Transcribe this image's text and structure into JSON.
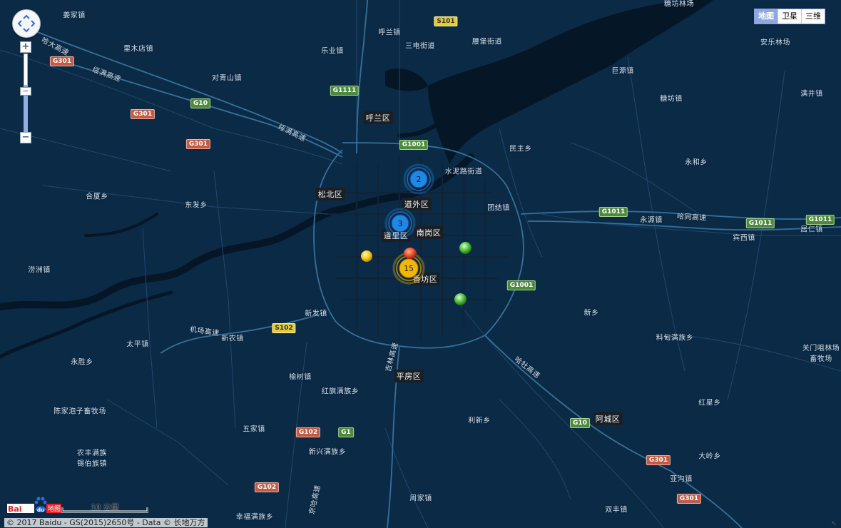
{
  "map": {
    "map_type_buttons": [
      {
        "label": "地图",
        "active": true
      },
      {
        "label": "卫星",
        "active": false
      },
      {
        "label": "三维",
        "active": false
      }
    ],
    "zoom": {
      "in_label": "+",
      "out_label": "−",
      "knob_label": "−",
      "level_fraction": 0.6
    },
    "scale_label": "10 公里",
    "copyright": "© 2017 Baidu - GS(2015)2650号 - Data © 长地万方",
    "logo_text": "Bai地图",
    "resize_glyph": "↖",
    "district_labels": [
      "呼兰区",
      "松北区",
      "道外区",
      "道里区",
      "南岗区",
      "香坊区",
      "平房区",
      "阿城区"
    ],
    "place_labels": [
      "姜家镇",
      "呼兰镇",
      "三电街道",
      "腰堡街道",
      "里木店镇",
      "乐业镇",
      "对青山镇",
      "巨源镇",
      "安乐林场",
      "糖坊镇",
      "满井镇",
      "民主乡",
      "永和乡",
      "水泥路街道",
      "合厦乡",
      "东发乡",
      "团结镇",
      "永源镇",
      "宾西镇",
      "居仁镇",
      "涝洲镇",
      "新发镇",
      "新乡",
      "新农镇",
      "太平镇",
      "料甸满族乡",
      "关门咀林场 畜牧场",
      "永胜乡",
      "榆树镇",
      "红旗满族乡",
      "红星乡",
      "陈家泡子畜牧场",
      "利新乡",
      "五家镇",
      "新兴满族乡",
      "大岭乡",
      "农丰满族 锡伯族镇",
      "亚沟镇",
      "周家镇",
      "幸福满族乡",
      "双丰镇",
      "糖坊林场"
    ],
    "road_labels": [
      "哈大高速",
      "绥满高速",
      "机场高速",
      "哈同高速",
      "吉林高速",
      "哈牡高速",
      "京哈高速"
    ],
    "highway_shields": [
      {
        "code": "S101",
        "color": "yellow"
      },
      {
        "code": "G301",
        "color": "red"
      },
      {
        "code": "G10",
        "color": "green"
      },
      {
        "code": "G1111",
        "color": "green"
      },
      {
        "code": "G301",
        "color": "red"
      },
      {
        "code": "G301",
        "color": "red"
      },
      {
        "code": "G1001",
        "color": "green"
      },
      {
        "code": "G1011",
        "color": "green"
      },
      {
        "code": "G1011",
        "color": "green"
      },
      {
        "code": "G1011",
        "color": "green"
      },
      {
        "code": "G1001",
        "color": "green"
      },
      {
        "code": "S102",
        "color": "yellow"
      },
      {
        "code": "G102",
        "color": "red"
      },
      {
        "code": "G1",
        "color": "green"
      },
      {
        "code": "G10",
        "color": "green"
      },
      {
        "code": "G301",
        "color": "red"
      },
      {
        "code": "G102",
        "color": "red"
      },
      {
        "code": "G301",
        "color": "red"
      }
    ],
    "cluster_markers": [
      {
        "count": "2",
        "color": "#1e88e5"
      },
      {
        "count": "3",
        "color": "#1e88e5"
      },
      {
        "count": "15",
        "color": "#f2b705"
      }
    ],
    "point_markers": [
      {
        "color": "#f5c518"
      },
      {
        "color": "#e84a2a"
      },
      {
        "color": "#4cbf3a"
      },
      {
        "color": "#4cbf3a"
      }
    ]
  }
}
